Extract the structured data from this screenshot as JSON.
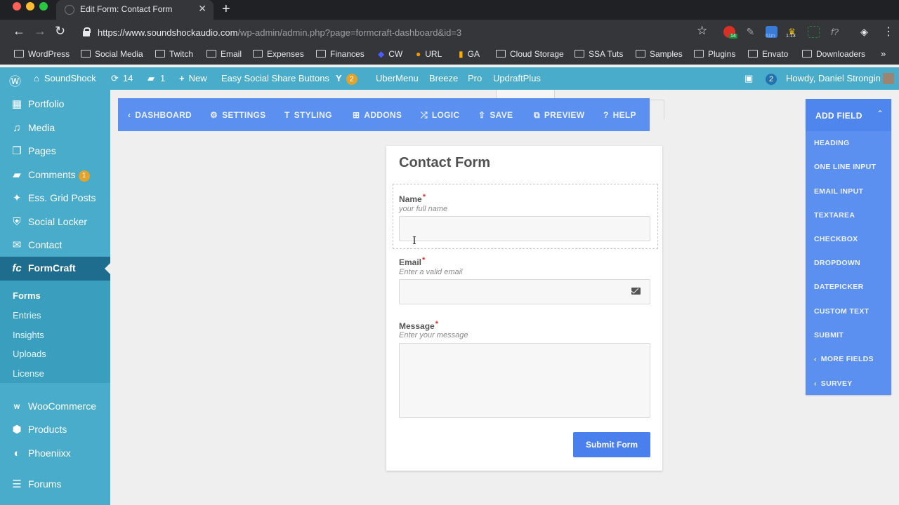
{
  "browser": {
    "tab_title": "Edit Form: Contact Form",
    "url_host": "https://www.soundshockaudio.com",
    "url_path": "/wp-admin/admin.php?page=formcraft-dashboard&id=3",
    "extensions": {
      "badge_1": "14",
      "badge_2": "61m",
      "badge_3": "1:13"
    },
    "bookmarks": [
      "WordPress",
      "Social Media",
      "Twitch",
      "Email",
      "Expenses",
      "Finances",
      "CW",
      "URL",
      "GA",
      "Cloud Storage",
      "SSA Tuts",
      "Samples",
      "Plugins",
      "Envato",
      "Downloaders"
    ],
    "bookmarks_more": "»"
  },
  "adminbar": {
    "site_name": "SoundShock",
    "updates_count": "14",
    "comments_count": "1",
    "new_label": "New",
    "items": [
      "Easy Social Share Buttons",
      "UberMenu",
      "Breeze",
      "Pro",
      "UpdraftPlus"
    ],
    "yoast_count": "2",
    "notif_count": "2",
    "greeting": "Howdy, Daniel Strongin"
  },
  "sidebar": {
    "items": [
      "Portfolio",
      "Media",
      "Pages",
      "Comments",
      "Ess. Grid Posts",
      "Social Locker",
      "Contact",
      "FormCraft",
      "WooCommerce",
      "Products",
      "Phoeniixx",
      "Forums"
    ],
    "comments_badge": "1",
    "submenu": [
      "Forms",
      "Entries",
      "Insights",
      "Uploads",
      "License"
    ]
  },
  "fc_toolbar": {
    "buttons": [
      "DASHBOARD",
      "SETTINGS",
      "STYLING",
      "ADDONS",
      "LOGIC",
      "SAVE",
      "PREVIEW",
      "HELP"
    ]
  },
  "form": {
    "title": "Contact Form",
    "fields": [
      {
        "label": "Name",
        "required_mark": "*",
        "help": "your full name",
        "value": ""
      },
      {
        "label": "Email",
        "required_mark": "*",
        "help": "Enter a valid email",
        "value": ""
      },
      {
        "label": "Message",
        "required_mark": "*",
        "help": "Enter your message",
        "value": ""
      }
    ],
    "submit_label": "Submit Form"
  },
  "add_field_panel": {
    "title": "ADD FIELD",
    "items": [
      "HEADING",
      "ONE LINE INPUT",
      "EMAIL INPUT",
      "TEXTAREA",
      "CHECKBOX",
      "DROPDOWN",
      "DATEPICKER",
      "CUSTOM TEXT",
      "SUBMIT",
      "MORE FIELDS",
      "SURVEY"
    ]
  },
  "colors": {
    "wp_admin": "#4aaccb",
    "wp_admin_active": "#1e6d8f",
    "formcraft_blue": "#5b8ff0",
    "submit_blue": "#4a80ee",
    "required_red": "#e02f2f"
  }
}
